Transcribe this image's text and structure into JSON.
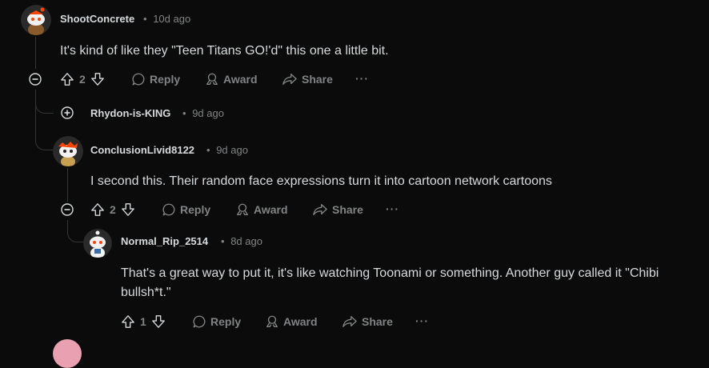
{
  "comments": [
    {
      "username": "ShootConcrete",
      "age": "10d ago",
      "text": "It's kind of like they \"Teen Titans GO!'d\" this one a little bit.",
      "votes": "2"
    },
    {
      "username": "Rhydon-is-KING",
      "age": "9d ago",
      "collapsed": true
    },
    {
      "username": "ConclusionLivid8122",
      "age": "9d ago",
      "text": "I second this. Their random face expressions turn it into cartoon network cartoons",
      "votes": "2"
    },
    {
      "username": "Normal_Rip_2514",
      "age": "8d ago",
      "text": "That's a great way to put it, it's like watching Toonami or something. Another guy called it \"Chibi bullsh*t.\"",
      "votes": "1"
    }
  ],
  "actions": {
    "reply": "Reply",
    "award": "Award",
    "share": "Share",
    "more": "···"
  },
  "separator": "•",
  "colors": {
    "background": "#0b0b0b",
    "text": "#d7dadc",
    "muted": "#818384",
    "thread_line": "#343536",
    "avatar_orange": "#ff4500"
  },
  "icons": [
    "avatar-icon",
    "upvote-icon",
    "downvote-icon",
    "reply-icon",
    "award-icon",
    "share-icon",
    "collapse-icon",
    "expand-icon"
  ]
}
